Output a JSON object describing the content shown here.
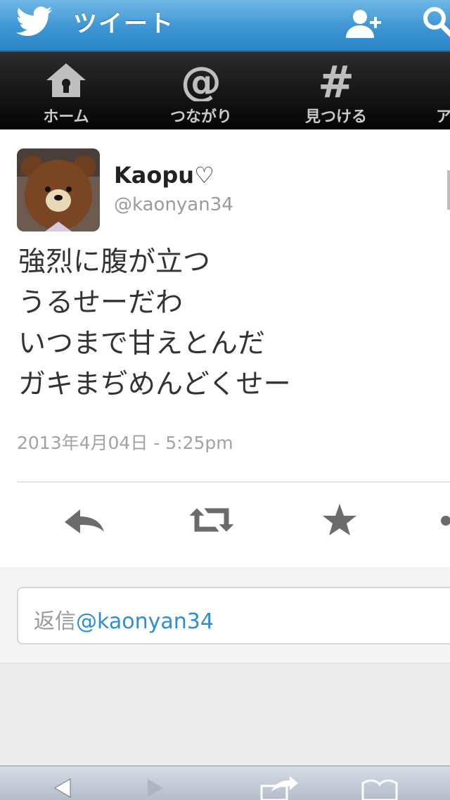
{
  "header": {
    "title": "ツイート"
  },
  "nav": {
    "items": [
      {
        "label": "ホーム",
        "icon": "home-icon"
      },
      {
        "label": "つながり",
        "icon": "at-icon"
      },
      {
        "label": "見つける",
        "icon": "hash-icon"
      },
      {
        "label": "ア",
        "icon": "person-icon"
      }
    ]
  },
  "tweet": {
    "name": "Kaopu♡",
    "handle": "@kaonyan34",
    "lines": [
      "強烈に腹が立つ",
      "うるせーだわ",
      "いつまで甘えとんだ",
      "ガキまぢめんどくせー"
    ],
    "timestamp": "2013年4月04日 - 5:25pm"
  },
  "reply": {
    "prefix": "返信",
    "mention": "@kaonyan34"
  },
  "colors": {
    "header_blue": "#3d95d2",
    "link_blue": "#2d8fd1",
    "nav_black": "#141414"
  }
}
